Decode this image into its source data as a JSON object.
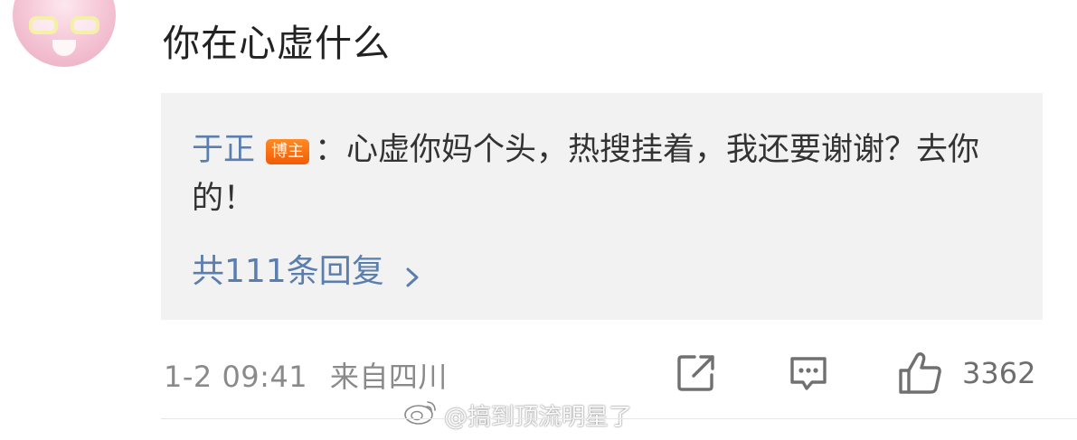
{
  "comment": {
    "text": "你在心虚什么"
  },
  "reply": {
    "author": "于正",
    "badge": "博主",
    "text": "：心虚你妈个头，热搜挂着，我还要谢谢？去你的！",
    "more_label": "共111条回复"
  },
  "meta": {
    "timestamp": "1-2 09:41",
    "location": "来自四川"
  },
  "actions": {
    "share_icon": "share-icon",
    "comment_icon": "comment-icon",
    "like_icon": "like-icon",
    "like_count": "3362"
  },
  "watermark": {
    "text": "@搞到顶流明星了"
  },
  "colors": {
    "link": "#5a7ead",
    "badge": "#f25c05",
    "reply_bg": "#f2f2f2"
  }
}
